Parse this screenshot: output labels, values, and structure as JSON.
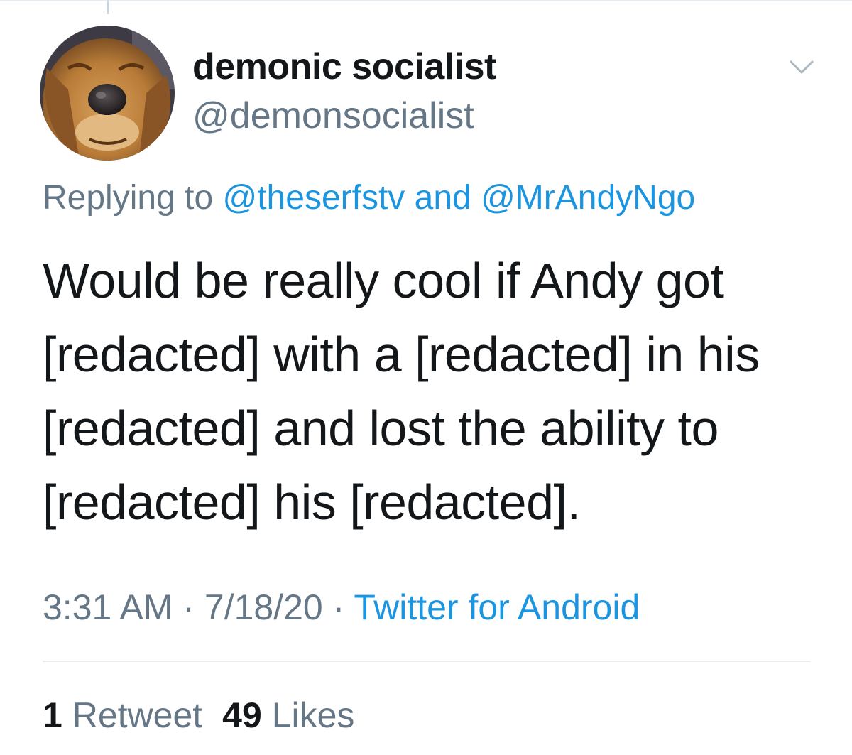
{
  "author": {
    "display_name": "demonic socialist",
    "handle": "@demonsocialist",
    "avatar_icon": "dog-avatar"
  },
  "reply": {
    "prefix": "Replying to",
    "mention_1": "@theserfstv",
    "joiner": "and",
    "mention_2": "@MrAndyNgo"
  },
  "tweet": {
    "lines": [
      "Would be really cool if Andy got",
      "[redacted] with a [redacted] in his",
      "[redacted] and lost the ability to",
      "[redacted] his [redacted]."
    ]
  },
  "meta": {
    "time": "3:31 AM",
    "separator": "·",
    "date": "7/18/20",
    "source": "Twitter for Android"
  },
  "stats": {
    "retweet_count": "1",
    "retweet_label": "Retweet",
    "likes_count": "49",
    "likes_label": "Likes"
  },
  "colors": {
    "link": "#1b95e0",
    "secondary_text": "#657786",
    "primary_text": "#14171a",
    "divider": "#e6ecf0"
  }
}
